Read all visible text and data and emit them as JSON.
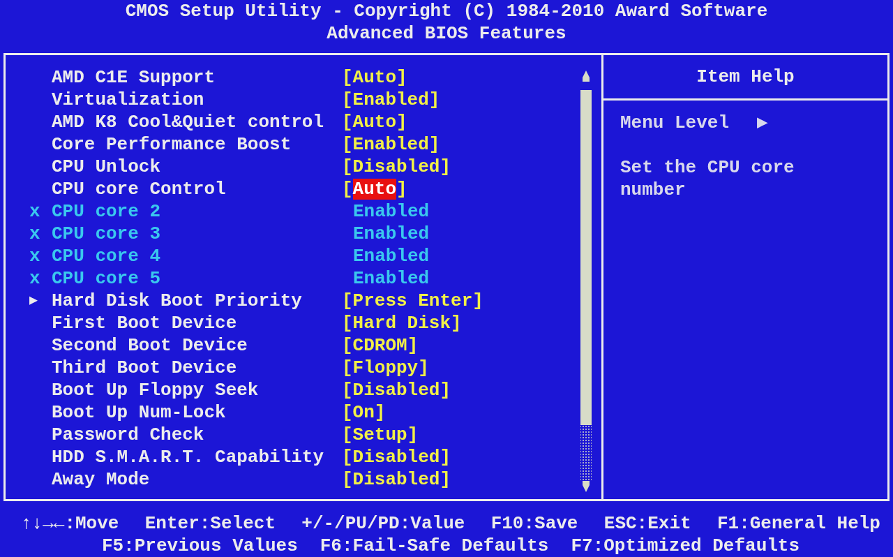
{
  "header": {
    "title": "CMOS Setup Utility - Copyright (C) 1984-2010 Award Software",
    "subtitle": "Advanced BIOS Features"
  },
  "brackets": {
    "open": "[",
    "close": "]"
  },
  "settings": [
    {
      "label": "AMD C1E Support",
      "value": "Auto",
      "selected": false,
      "disabled": false
    },
    {
      "label": "Virtualization",
      "value": "Enabled",
      "selected": false,
      "disabled": false
    },
    {
      "label": "AMD K8 Cool&Quiet control",
      "value": "Auto",
      "selected": false,
      "disabled": false
    },
    {
      "label": "Core Performance Boost",
      "value": "Enabled",
      "selected": false,
      "disabled": false
    },
    {
      "label": "CPU Unlock",
      "value": "Disabled",
      "selected": false,
      "disabled": false
    },
    {
      "label": "CPU core Control",
      "value": "Auto",
      "selected": true,
      "disabled": false
    },
    {
      "marker": "x",
      "label": "CPU core 2",
      "value": "Enabled",
      "selected": false,
      "disabled": true
    },
    {
      "marker": "x",
      "label": "CPU core 3",
      "value": "Enabled",
      "selected": false,
      "disabled": true
    },
    {
      "marker": "x",
      "label": "CPU core 4",
      "value": "Enabled",
      "selected": false,
      "disabled": true
    },
    {
      "marker": "x",
      "label": "CPU core 5",
      "value": "Enabled",
      "selected": false,
      "disabled": true
    },
    {
      "marker": "▶",
      "label": "Hard Disk Boot Priority",
      "value": "Press Enter",
      "selected": false,
      "disabled": false
    },
    {
      "label": "First Boot Device",
      "value": "Hard Disk",
      "selected": false,
      "disabled": false
    },
    {
      "label": "Second Boot Device",
      "value": "CDROM",
      "selected": false,
      "disabled": false
    },
    {
      "label": "Third Boot Device",
      "value": "Floppy",
      "selected": false,
      "disabled": false
    },
    {
      "label": "Boot Up Floppy Seek",
      "value": "Disabled",
      "selected": false,
      "disabled": false
    },
    {
      "label": "Boot Up Num-Lock",
      "value": "On",
      "selected": false,
      "disabled": false
    },
    {
      "label": "Password Check",
      "value": "Setup",
      "selected": false,
      "disabled": false
    },
    {
      "label": "HDD S.M.A.R.T. Capability",
      "value": "Disabled",
      "selected": false,
      "disabled": false
    },
    {
      "label": "Away Mode",
      "value": "Disabled",
      "selected": false,
      "disabled": false
    }
  ],
  "item_help": {
    "title": "Item Help",
    "menu_level": "Menu Level",
    "menu_level_marker": "▶",
    "description": "Set the CPU core number"
  },
  "footer": [
    [
      "↑↓→←:Move",
      "Enter:Select",
      "+/-/PU/PD:Value",
      "F10:Save",
      "ESC:Exit",
      "F1:General Help"
    ],
    [
      "F5:Previous Values",
      "F6:Fail-Safe Defaults",
      "F7:Optimized Defaults"
    ]
  ]
}
